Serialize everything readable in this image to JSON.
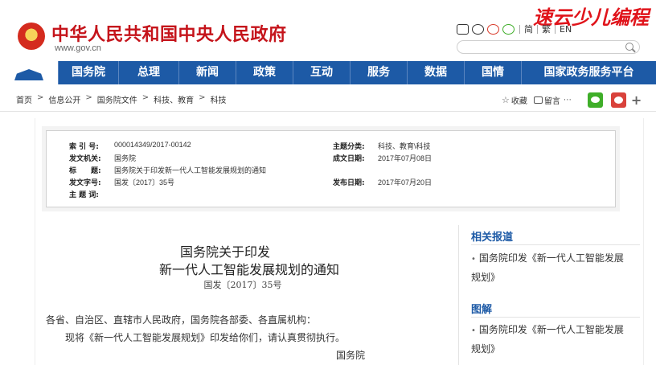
{
  "header": {
    "site_title": "中华人民共和国中央人民政府",
    "site_url": "www.gov.cn",
    "watermark": "速云少儿编程",
    "tools": {
      "link1": "简",
      "link2": "繁",
      "link3": "EN"
    }
  },
  "nav": {
    "items": [
      "国务院",
      "总理",
      "新闻",
      "政策",
      "互动",
      "服务",
      "数据",
      "国情",
      "国家政务服务平台"
    ]
  },
  "breadcrumb": [
    "首页",
    "信息公开",
    "国务院文件",
    "科技、教育",
    "科技"
  ],
  "toolbar": {
    "favorite_label": "收藏",
    "comment_label": "留言"
  },
  "info": {
    "index_label": "索 引 号:",
    "index_value": "000014349/2017-00142",
    "topic_label": "主题分类:",
    "topic_value": "科技、教育\\科技",
    "issuer_label": "发文机关:",
    "issuer_value": "国务院",
    "written_label": "成文日期:",
    "written_value": "2017年07月08日",
    "title_label": "标　　题:",
    "title_value": "国务院关于印发新一代人工智能发展规划的通知",
    "docno_label": "发文字号:",
    "docno_value": "国发〔2017〕35号",
    "published_label": "发布日期:",
    "published_value": "2017年07月20日",
    "keywords_label": "主 题 词:",
    "keywords_value": ""
  },
  "article": {
    "title_line1": "国务院关于印发",
    "title_line2": "新一代人工智能发展规划的通知",
    "docno": "国发〔2017〕35号",
    "addressee": "各省、自治区、直辖市人民政府，国务院各部委、各直属机构：",
    "body": "现将《新一代人工智能发展规划》印发给你们，请认真贯彻执行。",
    "signature": "国务院"
  },
  "sidebar": {
    "related_heading": "相关报道",
    "related_items": [
      "国务院印发《新一代人工智能发展规划》"
    ],
    "graphic_heading": "图解",
    "graphic_items": [
      "国务院印发《新一代人工智能发展规划》"
    ]
  }
}
